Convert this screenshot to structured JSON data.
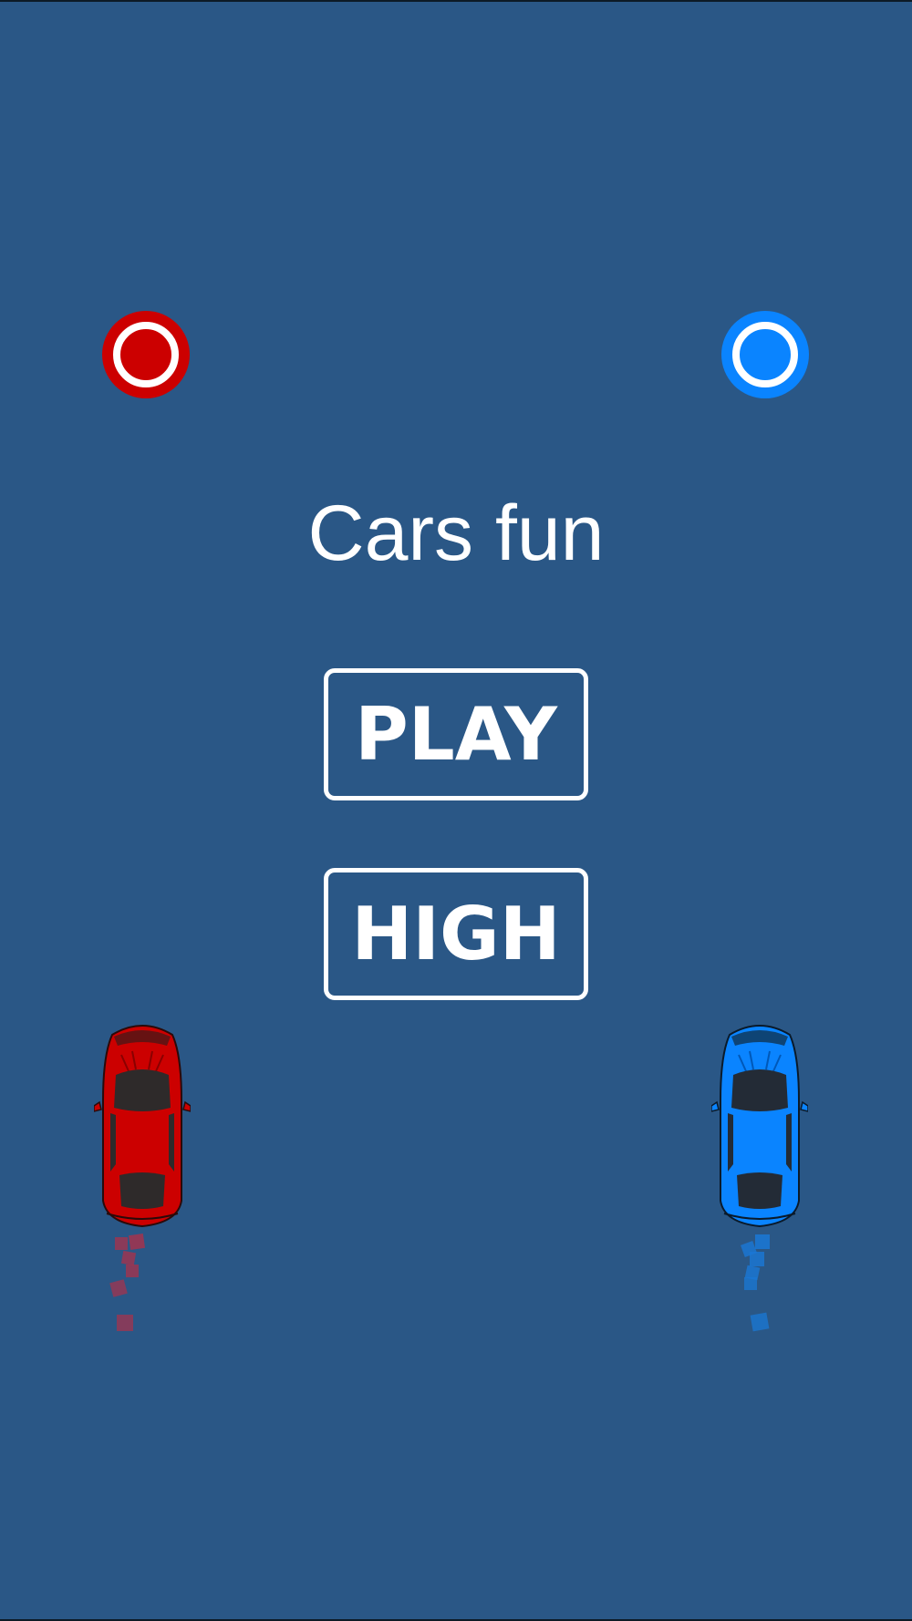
{
  "game": {
    "title": "Cars fun",
    "buttons": {
      "play_label": "PLAY",
      "high_label": "HIGH"
    }
  },
  "colors": {
    "background": "#2a5786",
    "red_player": "#cc0000",
    "blue_player": "#0a84ff",
    "text": "#ffffff"
  },
  "icons": {
    "red_target": "circle-target-icon",
    "blue_target": "circle-target-icon",
    "red_car": "car-icon",
    "blue_car": "car-icon"
  }
}
